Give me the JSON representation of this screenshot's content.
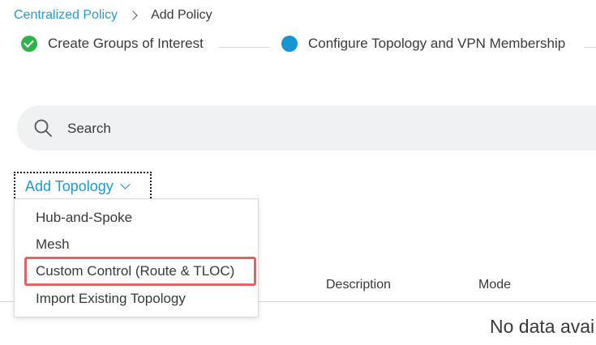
{
  "breadcrumb": {
    "parent": "Centralized Policy",
    "current": "Add Policy"
  },
  "stepper": {
    "steps": [
      {
        "label": "Create Groups of Interest",
        "state": "completed",
        "color": "#2db34a"
      },
      {
        "label": "Configure Topology and VPN Membership",
        "state": "active",
        "color": "#1595d4"
      }
    ]
  },
  "search": {
    "placeholder": "Search",
    "value": ""
  },
  "add_topology": {
    "label": "Add Topology"
  },
  "dropdown": {
    "items": [
      {
        "label": "Hub-and-Spoke"
      },
      {
        "label": "Mesh"
      },
      {
        "label": "Custom Control (Route & TLOC)",
        "highlighted": true
      },
      {
        "label": "Import Existing Topology"
      }
    ]
  },
  "table": {
    "columns": [
      "Description",
      "Mode"
    ],
    "empty_text": "No data avai"
  },
  "colors": {
    "accent": "#1e9ac9",
    "highlight": "#e2635f"
  }
}
